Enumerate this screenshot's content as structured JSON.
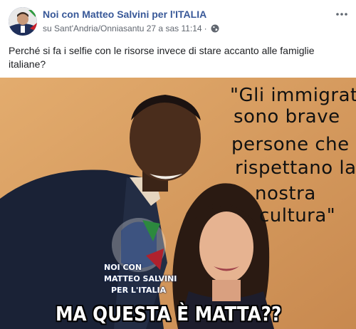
{
  "post": {
    "page_name": "Noi con Matteo Salvini per l'ITALIA",
    "meta": {
      "location_prefix": "su",
      "location": "Sant'Andria/Onniasantu",
      "date": "27 a sas 11:14",
      "separator": "·",
      "privacy_icon": "globe-icon"
    },
    "more_icon": "more-options-icon",
    "caption": "Perché si fa i selfie con le risorse invece di stare accanto alle famiglie italiane?"
  },
  "image": {
    "quote_lines": [
      "\"Gli immigrati",
      "sono brave",
      "persone che",
      "rispettano la",
      "nostra",
      "cultura\""
    ],
    "watermark_lines": [
      "NOI CON",
      "MATTEO SALVINI",
      "PER L'ITALIA"
    ],
    "bottom_text": "MA QUESTA È MATTA??"
  },
  "colors": {
    "link": "#385898",
    "meta": "#616770",
    "photo_background": "#d9a365"
  }
}
